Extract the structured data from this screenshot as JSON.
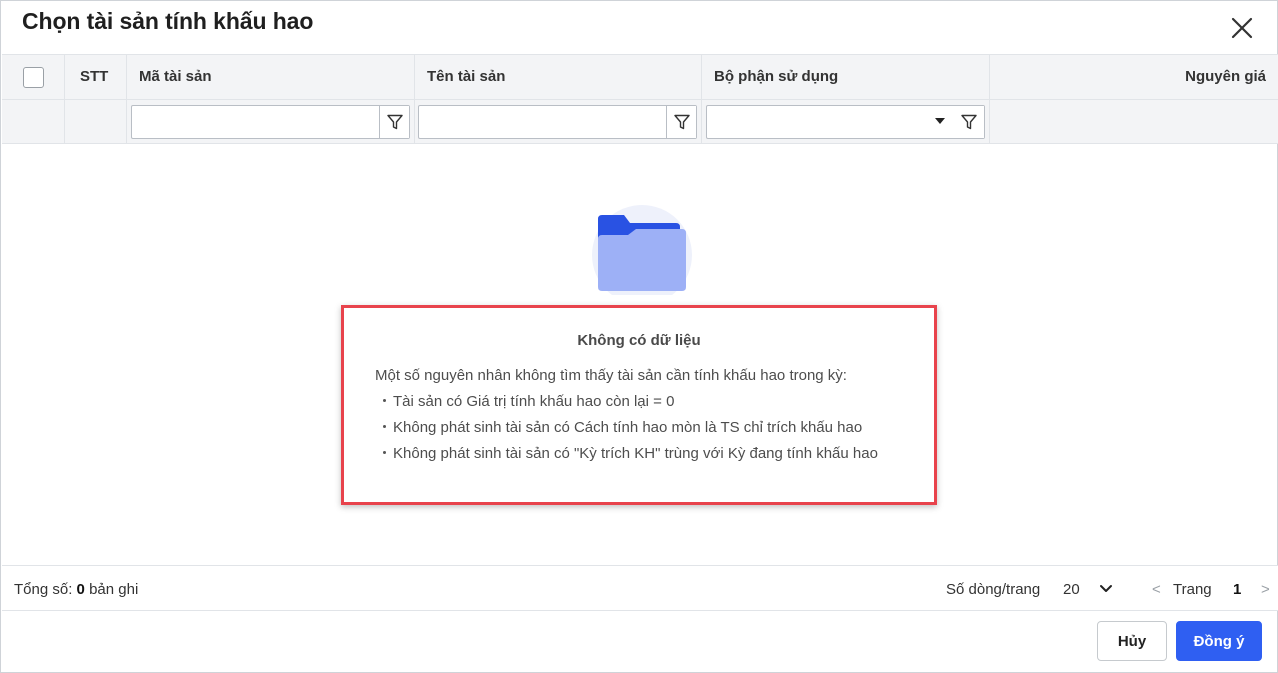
{
  "dialog": {
    "title": "Chọn tài sản tính khấu hao"
  },
  "table": {
    "columns": {
      "stt": "STT",
      "asset_code": "Mã tài sản",
      "asset_name": "Tên tài sản",
      "department": "Bộ phận sử dụng",
      "original_price": "Nguyên giá"
    },
    "filters": {
      "asset_code": "",
      "asset_name": "",
      "department": ""
    },
    "rows": []
  },
  "empty_state": {
    "icon": "folder-icon",
    "title": "Không có dữ liệu",
    "intro": "Một số nguyên nhân không tìm thấy tài sản cần tính khấu hao trong kỳ:",
    "reasons": [
      "Tài sản có Giá trị tính khấu hao còn lại = 0",
      "Không phát sinh tài sản có Cách tính hao mòn là TS chỉ trích khấu hao",
      "Không phát sinh tài sản có \"Kỳ trích KH\" trùng với Kỳ đang tính khấu hao"
    ]
  },
  "footer": {
    "total_label": "Tổng số:",
    "total_count": "0",
    "total_unit": "bản ghi",
    "rows_per_page_label": "Số dòng/trang",
    "rows_per_page_value": "20",
    "page_prev": "<",
    "page_label": "Trang",
    "page_number": "1",
    "page_next": ">"
  },
  "actions": {
    "cancel_label": "Hủy",
    "ok_label": "Đồng ý"
  },
  "colors": {
    "accent": "#2f5ff2",
    "highlight_border": "#e8434c",
    "header_bg": "#f3f4f6",
    "folder_dark": "#2952e3",
    "folder_light": "#9db0f6",
    "folder_bg": "#eef1fb"
  }
}
